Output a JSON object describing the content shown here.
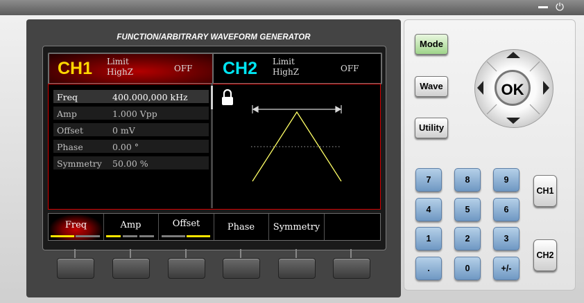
{
  "window": {
    "minimize_icon": "minimize-icon",
    "power_icon": "power-icon"
  },
  "device": {
    "title": "FUNCTION/ARBITRARY WAVEFORM GENERATOR"
  },
  "channels": {
    "ch1": {
      "label": "CH1",
      "limit": "Limit",
      "impedance": "HighZ",
      "state": "OFF",
      "color": "#ffd800"
    },
    "ch2": {
      "label": "CH2",
      "limit": "Limit",
      "impedance": "HighZ",
      "state": "OFF",
      "color": "#00e5f2"
    }
  },
  "params": [
    {
      "name": "Freq",
      "value": "400.000,000 kHz"
    },
    {
      "name": "Amp",
      "value": "1.000 Vpp"
    },
    {
      "name": "Offset",
      "value": "0 mV"
    },
    {
      "name": "Phase",
      "value": "0.00 °"
    },
    {
      "name": "Symmetry",
      "value": "50.00 %"
    }
  ],
  "waveform": {
    "type": "triangle",
    "lock_icon": "lock-icon",
    "symmetry_percent": 50,
    "line_color": "#ffff66"
  },
  "softkeys": [
    {
      "label": "Freq",
      "active": true
    },
    {
      "label": "Amp",
      "active": false
    },
    {
      "label": "Offset",
      "active": false
    },
    {
      "label": "Phase",
      "active": false
    },
    {
      "label": "Symmetry",
      "active": false
    },
    {
      "label": "",
      "active": false
    }
  ],
  "function_buttons": {
    "mode": "Mode",
    "wave": "Wave",
    "utility": "Utility"
  },
  "nav": {
    "ok": "OK"
  },
  "keypad": [
    "7",
    "8",
    "9",
    "4",
    "5",
    "6",
    "1",
    "2",
    "3",
    ".",
    "0",
    "+/-"
  ],
  "channel_buttons": {
    "ch1": "CH1",
    "ch2": "CH2"
  }
}
